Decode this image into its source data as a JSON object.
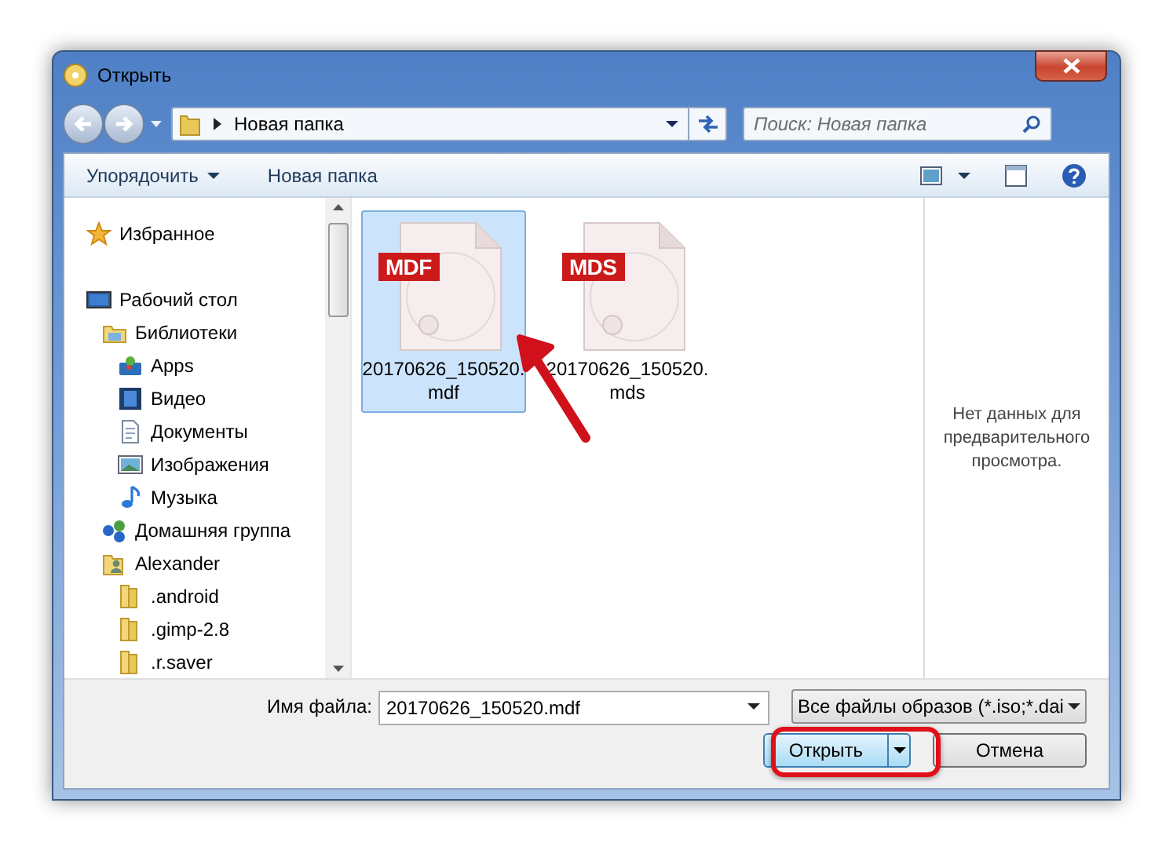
{
  "window": {
    "title": "Открыть"
  },
  "address": {
    "path": "Новая папка"
  },
  "search": {
    "placeholder": "Поиск: Новая папка"
  },
  "toolbar": {
    "organize": "Упорядочить",
    "new_folder": "Новая папка"
  },
  "nav": [
    {
      "label": "Избранное",
      "kind": "star"
    },
    {
      "label": "Рабочий стол",
      "kind": "desktop",
      "children": [
        {
          "label": "Библиотеки",
          "kind": "library",
          "children": [
            {
              "label": "Apps",
              "kind": "apps"
            },
            {
              "label": "Видео",
              "kind": "video"
            },
            {
              "label": "Документы",
              "kind": "document"
            },
            {
              "label": "Изображения",
              "kind": "image"
            },
            {
              "label": "Музыка",
              "kind": "music"
            }
          ]
        },
        {
          "label": "Домашняя группа",
          "kind": "homegroup"
        },
        {
          "label": "Alexander",
          "kind": "user",
          "children": [
            {
              "label": ".android",
              "kind": "folder"
            },
            {
              "label": ".gimp-2.8",
              "kind": "folder"
            },
            {
              "label": ".r.saver",
              "kind": "folder"
            }
          ]
        }
      ]
    }
  ],
  "files": [
    {
      "badge": "MDF",
      "name_lines": [
        "20170626_150520.",
        "mdf"
      ],
      "selected": true
    },
    {
      "badge": "MDS",
      "name_lines": [
        "20170626_150520.",
        "mds"
      ],
      "selected": false
    }
  ],
  "preview": {
    "message": "Нет данных для предварительного просмотра."
  },
  "filename": {
    "label": "Имя файла:",
    "value": "20170626_150520.mdf"
  },
  "filetype": {
    "value": "Все файлы образов (*.iso;*.dai"
  },
  "buttons": [
    {
      "label": "Открыть",
      "kind": "split"
    },
    {
      "label": "Отмена",
      "kind": "plain"
    }
  ]
}
